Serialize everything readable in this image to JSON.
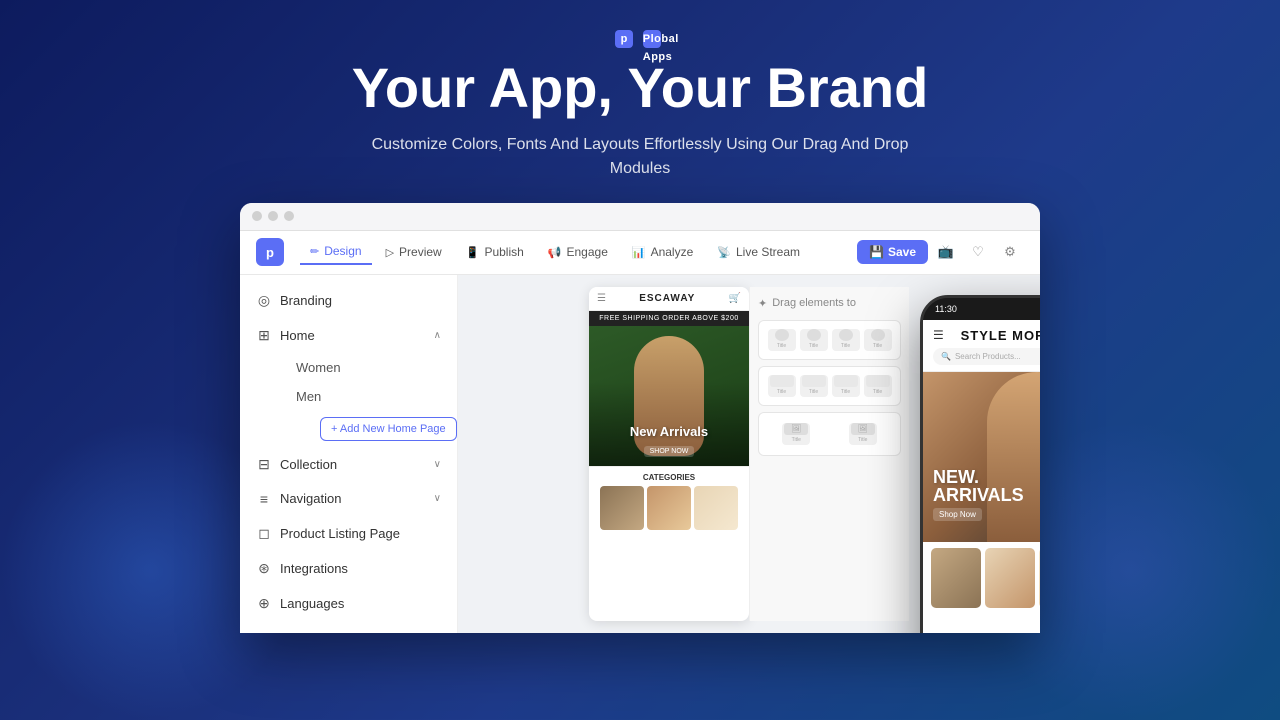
{
  "brand": {
    "name": "Plobal Apps",
    "logo_letter": "p"
  },
  "hero": {
    "title": "Your App, Your Brand",
    "subtitle": "Customize Colors, Fonts And Layouts Effortlessly Using Our Drag And Drop Modules"
  },
  "window": {
    "nav_tabs": [
      {
        "id": "design",
        "label": "Design",
        "icon": "✏",
        "active": true
      },
      {
        "id": "preview",
        "label": "Preview",
        "icon": "▷",
        "active": false
      },
      {
        "id": "publish",
        "label": "Publish",
        "icon": "📱",
        "active": false
      },
      {
        "id": "engage",
        "label": "Engage",
        "icon": "📢",
        "active": false
      },
      {
        "id": "analyze",
        "label": "Analyze",
        "icon": "📊",
        "active": false
      },
      {
        "id": "livestream",
        "label": "Live Stream",
        "icon": "📡",
        "active": false
      }
    ],
    "save_button": "Save"
  },
  "sidebar": {
    "items": [
      {
        "id": "branding",
        "label": "Branding",
        "icon": "◎",
        "expandable": false
      },
      {
        "id": "home",
        "label": "Home",
        "icon": "⊞",
        "expandable": true,
        "expanded": true,
        "children": [
          "Women",
          "Men"
        ],
        "add_btn": "+ Add New Home Page"
      },
      {
        "id": "collection",
        "label": "Collection",
        "icon": "⊟",
        "expandable": true,
        "expanded": false
      },
      {
        "id": "navigation",
        "label": "Navigation",
        "icon": "≡",
        "expandable": true,
        "expanded": false
      },
      {
        "id": "product_listing",
        "label": "Product Listing Page",
        "icon": "◻",
        "expandable": false
      },
      {
        "id": "integrations",
        "label": "Integrations",
        "icon": "⊛",
        "expandable": false
      },
      {
        "id": "languages",
        "label": "Languages",
        "icon": "⊕",
        "expandable": false
      }
    ]
  },
  "phone_preview": {
    "brand": "ESCAWAY",
    "banner_text": "FREE SHIPPING ORDER ABOVE $200",
    "new_arrivals": "New Arrivals",
    "shop_now": "SHOP NOW",
    "categories_label": "CATEGORIES"
  },
  "drag_panel": {
    "title": "Drag elements to"
  },
  "mobile_mockup": {
    "time": "11:30",
    "shop_name": "STYLE MORE",
    "search_placeholder": "Search Products...",
    "hero_text_line1": "NEW.",
    "hero_text_line2": "ARRIVALS",
    "shop_now": "Shop Now"
  }
}
